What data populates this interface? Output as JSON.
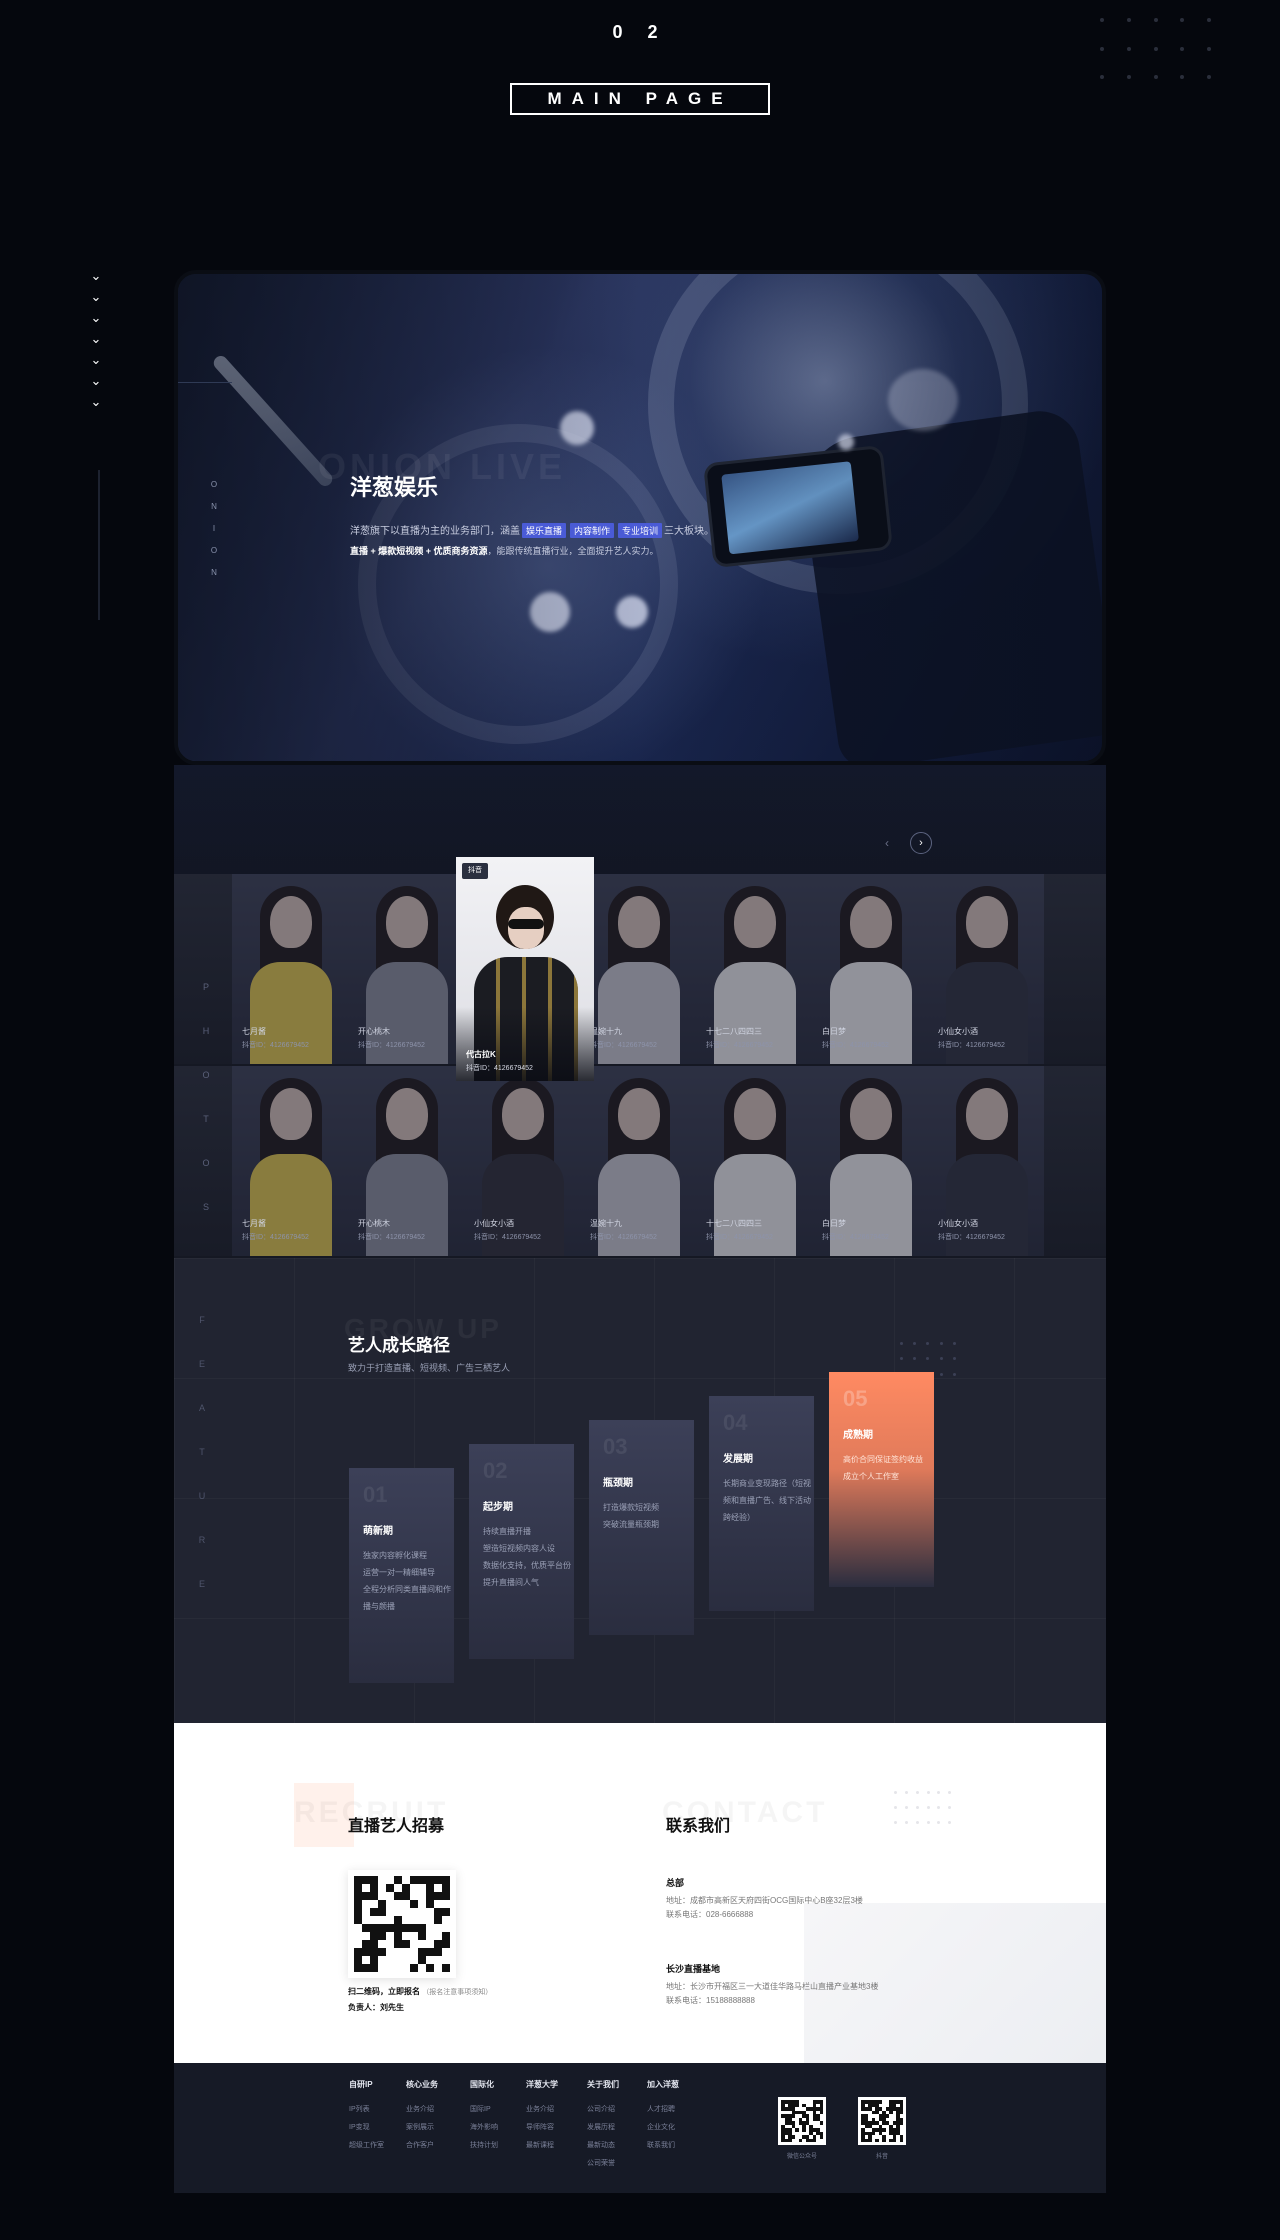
{
  "header": {
    "section_number": "0 2",
    "title": "MAIN PAGE"
  },
  "hero": {
    "ghost_text": "ONION LIVE",
    "vertical_letters": [
      "O",
      "N",
      "I",
      "O",
      "N"
    ],
    "title": "洋葱娱乐",
    "desc_prefix": "洋葱旗下以直播为主的业务部门，涵盖",
    "tags": [
      "娱乐直播",
      "内容制作",
      "专业培训"
    ],
    "desc_suffix": "三大板块。",
    "desc2_bold": "直播 + 爆款短视频 + 优质商务资源",
    "desc2_rest": "，能跟传统直播行业，全面提升艺人实力。",
    "prev_arrow": "‹",
    "next_arrow": "›"
  },
  "photos": {
    "vertical_letters": [
      "P",
      "H",
      "O",
      "T",
      "O",
      "S"
    ],
    "featured": {
      "badge": "抖音",
      "name": "代古拉K",
      "id": "抖音ID：4126679452"
    },
    "row1": [
      {
        "name": "七月酱",
        "id": "抖音ID：4126679452"
      },
      {
        "name": "开心桃木",
        "id": "抖音ID：4126679452"
      },
      {
        "name": "",
        "id": ""
      },
      {
        "name": "温婉十九",
        "id": "抖音ID：4126679452"
      },
      {
        "name": "十七二八四四三",
        "id": "抖音ID：4126679452"
      },
      {
        "name": "白日梦",
        "id": "抖音ID：4126679452"
      },
      {
        "name": "小仙女小酒",
        "id": "抖音ID：4126679452"
      }
    ],
    "row2": [
      {
        "name": "七月酱",
        "id": "抖音ID：4126679452"
      },
      {
        "name": "开心桃木",
        "id": "抖音ID：4126679452"
      },
      {
        "name": "小仙女小酒",
        "id": "抖音ID：4126679452"
      },
      {
        "name": "温婉十九",
        "id": "抖音ID：4126679452"
      },
      {
        "name": "十七二八四四三",
        "id": "抖音ID：4126679452"
      },
      {
        "name": "白日梦",
        "id": "抖音ID：4126679452"
      },
      {
        "name": "小仙女小酒",
        "id": "抖音ID：4126679452"
      }
    ]
  },
  "growth": {
    "ghost_text": "GROW UP",
    "vertical_letters": [
      "F",
      "E",
      "A",
      "T",
      "U",
      "R",
      "E"
    ],
    "title": "艺人成长路径",
    "subtitle": "致力于打造直播、短视频、广告三栖艺人",
    "steps": [
      {
        "num": "01",
        "title": "萌新期",
        "lines": [
          "独家内容孵化课程",
          "运营一对一精细辅导",
          "全程分析同类直播间和作",
          "播与颜播"
        ]
      },
      {
        "num": "02",
        "title": "起步期",
        "lines": [
          "持续直播开播",
          "塑造短视频内容人设",
          "数据化支持，优质平台份",
          "提升直播间人气"
        ]
      },
      {
        "num": "03",
        "title": "瓶颈期",
        "lines": [
          "打造爆款短视频",
          "突破流量瓶颈期"
        ]
      },
      {
        "num": "04",
        "title": "发展期",
        "lines": [
          "长期商业变现路径（短视",
          "频和直播广告、线下活动",
          "跨经验）"
        ]
      },
      {
        "num": "05",
        "title": "成熟期",
        "lines": [
          "高价合同保证签约收益",
          "成立个人工作室"
        ]
      }
    ]
  },
  "recruit": {
    "ghost_text": "RECRUIT",
    "title": "直播艺人招募",
    "scan_text": "扫二维码，立即报名",
    "scan_note": "（报名注意事项须知）",
    "contact_person": "负责人：刘先生"
  },
  "contact": {
    "ghost_text": "CONTACT",
    "title": "联系我们",
    "hq": {
      "heading": "总部",
      "address": "地址：成都市高新区天府四街OCG国际中心B座32层3楼",
      "phone": "联系电话：028-6666888"
    },
    "base": {
      "heading": "长沙直播基地",
      "address": "地址：长沙市开福区三一大道佳华路马栏山直播产业基地3楼",
      "phone": "联系电话：15188888888"
    }
  },
  "footer": {
    "columns": [
      {
        "title": "自研IP",
        "items": [
          "IP列表",
          "IP变现",
          "超级工作室"
        ]
      },
      {
        "title": "核心业务",
        "items": [
          "业务介绍",
          "案例展示",
          "合作客户"
        ]
      },
      {
        "title": "国际化",
        "items": [
          "国际IP",
          "海外影响",
          "扶持计划"
        ]
      },
      {
        "title": "洋葱大学",
        "items": [
          "业务介绍",
          "导师阵容",
          "最新课程"
        ]
      },
      {
        "title": "关于我们",
        "items": [
          "公司介绍",
          "发展历程",
          "最新动态",
          "公司荣誉"
        ]
      },
      {
        "title": "加入洋葱",
        "items": [
          "人才招聘",
          "企业文化",
          "联系我们"
        ]
      }
    ],
    "qr_labels": [
      "微信公众号",
      "抖音"
    ]
  }
}
